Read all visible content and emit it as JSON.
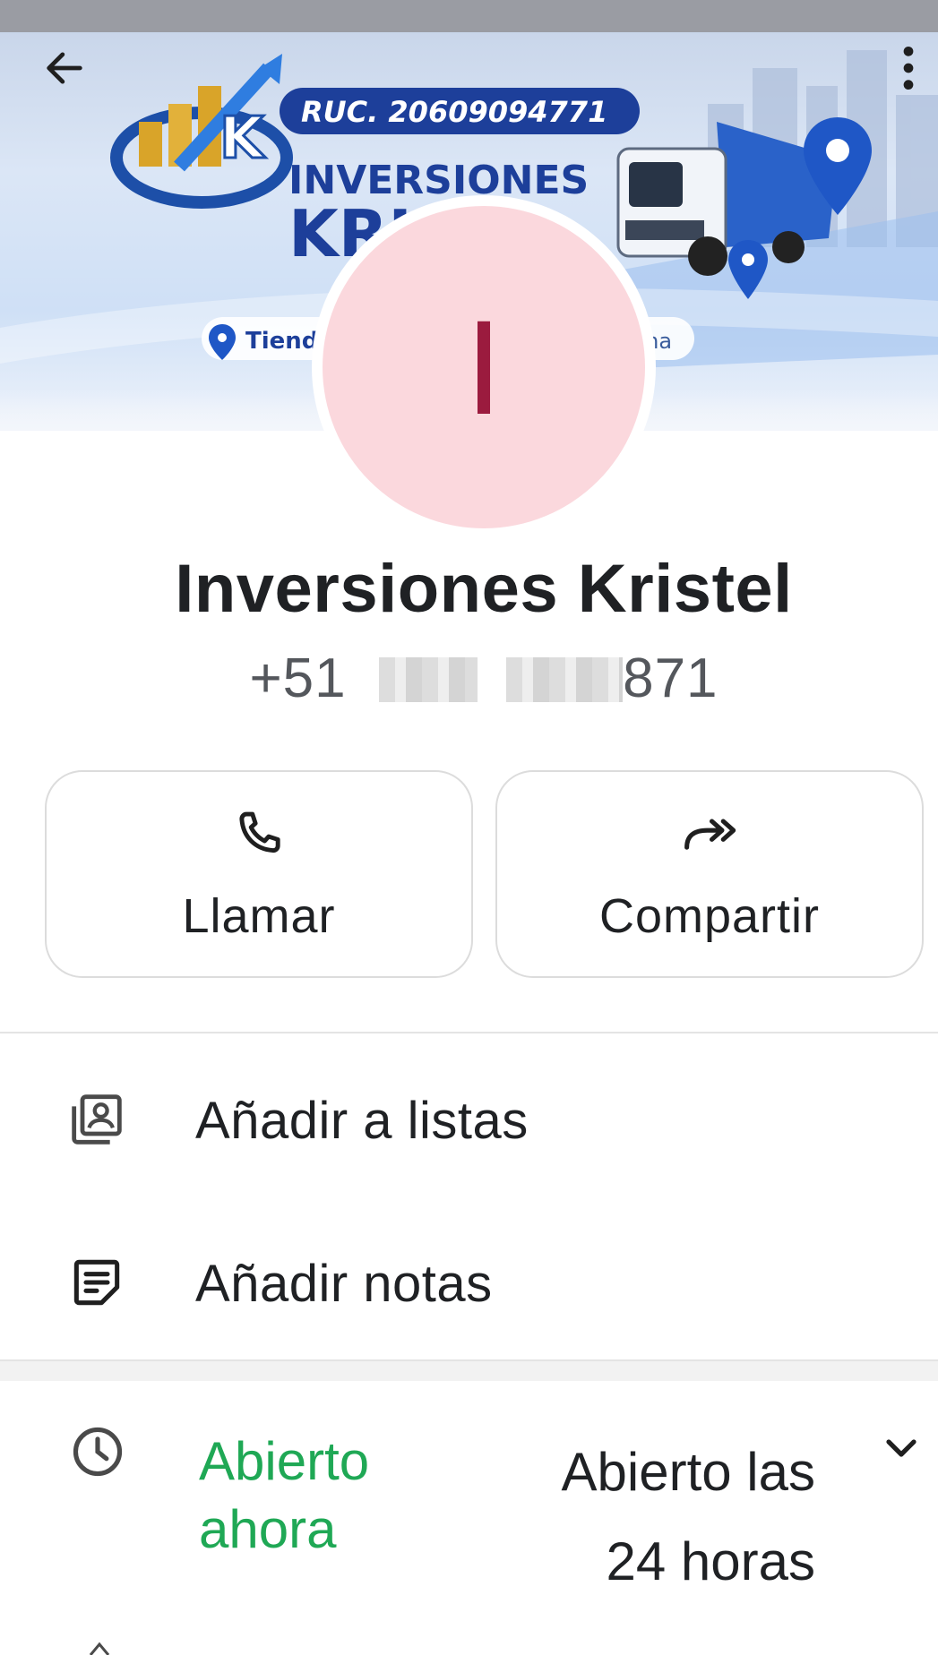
{
  "cover": {
    "ruc_text": "RUC. 20609094771",
    "brand_line1": "INVERSIONES",
    "brand_line2": "KRI",
    "location_left": "Tienda",
    "location_right": "ma"
  },
  "avatar": {
    "initial": "I",
    "bg_color": "#fbd8dd",
    "fg_color": "#9b1b3e"
  },
  "contact": {
    "name": "Inversiones Kristel",
    "phone_prefix": "+51",
    "phone_suffix": "871"
  },
  "actions": {
    "call_label": "Llamar",
    "share_label": "Compartir"
  },
  "menu": {
    "add_to_lists": "Añadir a listas",
    "add_notes": "Añadir notas"
  },
  "hours": {
    "status_line1": "Abierto",
    "status_line2": "ahora",
    "schedule_line1": "Abierto las",
    "schedule_line2": "24 horas",
    "status_color": "#1fa855"
  },
  "icons": {
    "back": "arrow-left-icon",
    "more": "more-vert-icon",
    "call": "phone-icon",
    "share": "share-forward-icon",
    "lists": "contact-list-icon",
    "notes": "note-icon",
    "clock": "clock-icon",
    "chevron": "chevron-down-icon"
  }
}
